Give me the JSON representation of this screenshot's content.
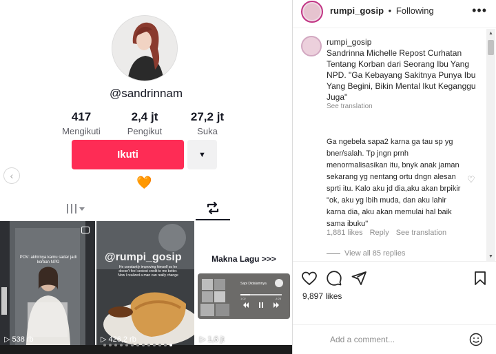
{
  "profile": {
    "username": "@sandrinnam",
    "stats": [
      {
        "num": "417",
        "label": "Mengikuti"
      },
      {
        "num": "2,4 jt",
        "label": "Pengikut"
      },
      {
        "num": "27,2 jt",
        "label": "Suka"
      }
    ],
    "follow_label": "Ikuti",
    "dropdown_icon": "caret-down-icon",
    "heart_emoji": "🧡",
    "nav_prev_icon": "chevron-left-icon"
  },
  "tabs": {
    "videos_icon": "grid-icon",
    "reposts_icon": "repost-icon"
  },
  "grid": [
    {
      "views": "538 rb",
      "text": "POV: akhirnya kamu sadar jadi korban NPD"
    },
    {
      "views": "426,2 rb",
      "text": "@rumpi_gosip",
      "sub": "He constantly improving himself so he doesn't feel sexiest credit to me better. Now I realized a man can really change"
    },
    {
      "views": "1,6 jt",
      "text": "Makna Lagu >>>",
      "player_title": "Sapi Didalamnya",
      "player_time_start": "1:02",
      "player_time_end": "-4:28"
    }
  ],
  "post": {
    "header_username": "rumpi_gosip",
    "header_separator": "•",
    "header_following": "Following",
    "more_icon": "more-icon",
    "caption_user": "rumpi_gosip",
    "caption": "Sandrinna Michelle Repost Curhatan Tentang Korban dari Seorang Ibu Yang NPD. \"Ga Kebayang Sakitnya Punya Ibu Yang Begini, Bikin Mental Ikut Keganggu Juga\"",
    "see_translation": "See translation",
    "comment_text": "Ga ngebela sapa2 karna ga tau sp yg bner/salah. Tp jngn prnh menormalisasikan itu, bnyk anak jaman sekarang yg nentang ortu dngn alesan sprti itu. Kalo aku jd dia,aku akan brpikir \"ok, aku yg lbih muda, dan aku lahir karna dia, aku akan memulai hal baik sama ibuku\"",
    "comment_likes": "1,881 likes",
    "reply_label": "Reply",
    "comment_see_translation": "See translation",
    "view_replies": "View all 85 replies",
    "likes": "9,897 likes",
    "add_comment_placeholder": "Add a comment...",
    "emoji_icon": "smiley-icon"
  },
  "colors": {
    "follow": "#fe2c55",
    "text_dark": "#161823",
    "muted": "#8e8e8e"
  }
}
